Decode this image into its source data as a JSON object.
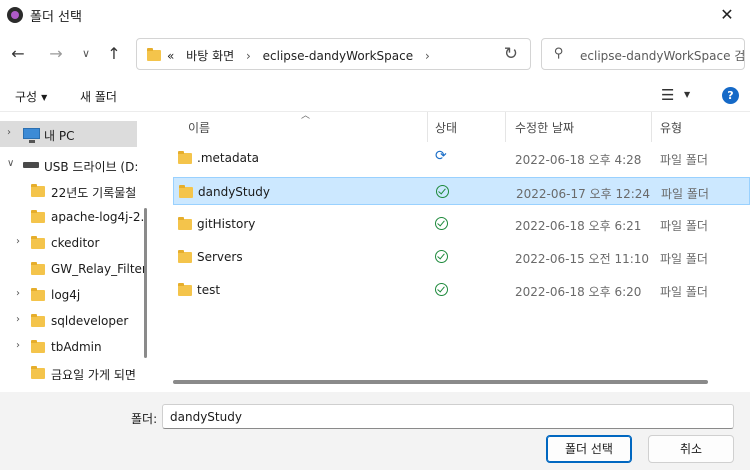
{
  "window": {
    "title": "폴더 선택",
    "close_glyph": "✕"
  },
  "nav": {
    "breadcrumb": [
      "«",
      "바탕 화면",
      "›",
      "eclipse-dandyWorkSpace",
      "›"
    ],
    "search_placeholder": "eclipse-dandyWorkSpace 검..."
  },
  "toolbar": {
    "organize_label": "구성",
    "new_folder_label": "새 폴더"
  },
  "tree": {
    "items": [
      {
        "label": "내 PC",
        "icon": "pc-icon",
        "expanded": false,
        "selected": true
      },
      {
        "label": "USB 드라이브 (D:",
        "icon": "usb-icon",
        "expanded": true
      },
      {
        "label": "22년도 기록물철",
        "icon": "folder-icon"
      },
      {
        "label": "apache-log4j-2.",
        "icon": "folder-icon"
      },
      {
        "label": "ckeditor",
        "icon": "folder-icon"
      },
      {
        "label": "GW_Relay_Filter",
        "icon": "folder-icon"
      },
      {
        "label": "log4j",
        "icon": "folder-icon"
      },
      {
        "label": "sqldeveloper",
        "icon": "folder-icon"
      },
      {
        "label": "tbAdmin",
        "icon": "folder-icon"
      },
      {
        "label": "금요일 가게 되면",
        "icon": "folder-icon"
      }
    ]
  },
  "columns": {
    "name": "이름",
    "status": "상태",
    "modified": "수정한 날짜",
    "type": "유형"
  },
  "files": [
    {
      "name": ".metadata",
      "status": "sync",
      "modified": "2022-06-18 오후 4:28",
      "type": "파일 폴더"
    },
    {
      "name": "dandyStudy",
      "status": "ok",
      "modified": "2022-06-17 오후 12:24",
      "type": "파일 폴더",
      "selected": true
    },
    {
      "name": "gitHistory",
      "status": "ok",
      "modified": "2022-06-18 오후 6:21",
      "type": "파일 폴더"
    },
    {
      "name": "Servers",
      "status": "ok",
      "modified": "2022-06-15 오전 11:10",
      "type": "파일 폴더"
    },
    {
      "name": "test",
      "status": "ok",
      "modified": "2022-06-18 오후 6:20",
      "type": "파일 폴더"
    }
  ],
  "footer": {
    "folder_label": "폴더:",
    "folder_value": "dandyStudy",
    "select_button": "폴더 선택",
    "cancel_button": "취소"
  },
  "colors": {
    "accent": "#0067c0",
    "selection": "#cce8ff",
    "folder": "#f4c44b",
    "help": "#1569c7",
    "status_ok": "#1e8a3c",
    "status_sync": "#1c6fc8"
  }
}
